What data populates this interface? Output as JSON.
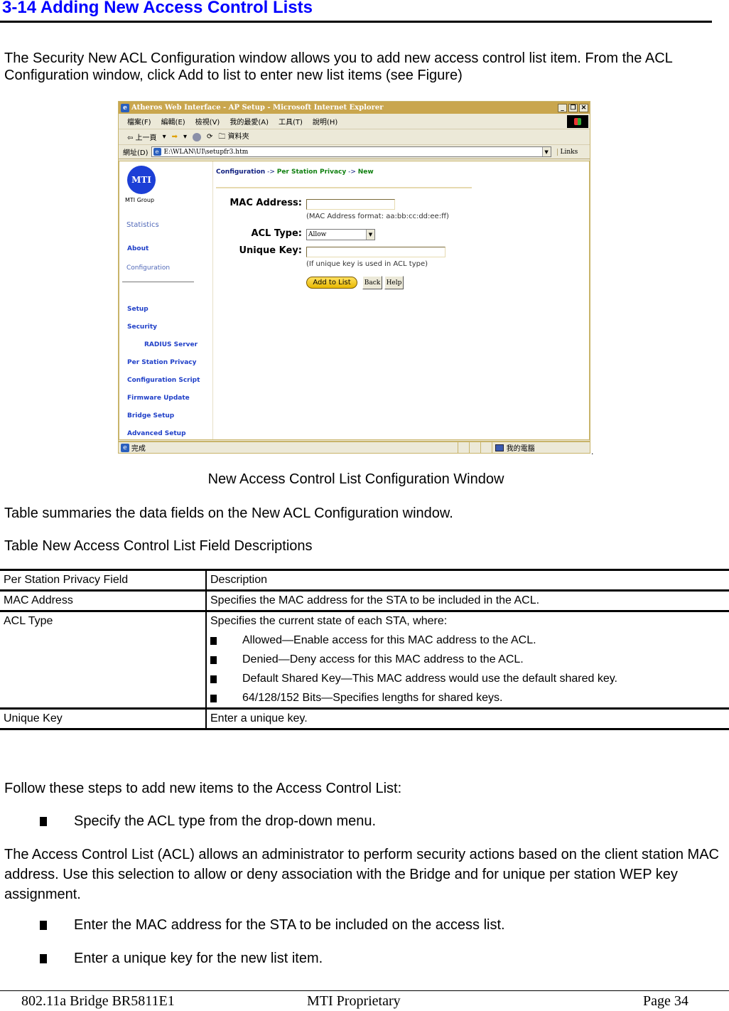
{
  "heading": "3-14 Adding New Access Control Lists",
  "intro": "The Security New ACL Configuration window allows you to add new access control list item. From the ACL Configuration window, click Add to list to enter new list items (see Figure)",
  "figure": {
    "window_title": "Atheros Web Interface - AP Setup - Microsoft Internet Explorer",
    "window_buttons": [
      "_",
      "❐",
      "✕"
    ],
    "menu": [
      "檔案(F)",
      "編輯(E)",
      "檢視(V)",
      "我的最愛(A)",
      "工具(T)",
      "說明(H)"
    ],
    "toolbar": {
      "back": "⇦ 上一頁",
      "back_drop": "▾",
      "forward": "➡",
      "forward_drop": "▾",
      "folders": "🗀 資料夾"
    },
    "address_label": "網址(D)",
    "address_value": "E:\\WLAN\\UI\\setupfr3.htm",
    "links_label": "Links",
    "sidebar": {
      "logo_text": "MTI",
      "brand": "MTI Group",
      "items": [
        {
          "label": "Statistics"
        },
        {
          "label": "About"
        },
        {
          "label": "Configuration"
        },
        {
          "label": "Setup"
        },
        {
          "label": "Security"
        },
        {
          "label": "RADIUS Server"
        },
        {
          "label": "Per Station Privacy"
        },
        {
          "label": "Configuration Script"
        },
        {
          "label": "Firmware Update"
        },
        {
          "label": "Bridge Setup"
        },
        {
          "label": "Advanced Setup"
        }
      ]
    },
    "breadcrumb": {
      "part1": "Configuration",
      "sep": " -> ",
      "part2": "Per Station Privacy",
      "part3": "New"
    },
    "form": {
      "mac_label": "MAC Address:",
      "mac_value": "",
      "mac_hint": "(MAC Address format: aa:bb:cc:dd:ee:ff)",
      "acl_label": "ACL Type:",
      "acl_selected": "Allow",
      "key_label": "Unique Key:",
      "key_value": "",
      "key_hint": "(If unique key is used in ACL type)",
      "add_button": "Add to List",
      "back_button": "Back",
      "help_button": "Help"
    },
    "status": {
      "text": "完成",
      "zone": "我的電腦"
    }
  },
  "caption": "New Access Control List Configuration Window",
  "table_intro": "Table summaries the data fields on the New ACL Configuration window.",
  "table_title": "Table New Access Control List Field Descriptions",
  "table": {
    "headers": [
      "Per Station Privacy Field",
      "Description"
    ],
    "rows": [
      {
        "field": "MAC Address",
        "description": "Specifies the MAC address for the STA to be included in the ACL."
      },
      {
        "field": "ACL Type",
        "description": "Specifies the current state of each STA, where:",
        "bullets": [
          "Allowed—Enable access for this MAC address to the ACL.",
          "Denied—Deny access for this MAC address to the ACL.",
          "Default Shared Key—This MAC address would use the default shared key.",
          "64/128/152 Bits—Specifies lengths for shared keys."
        ]
      },
      {
        "field": "Unique Key",
        "description": "Enter a unique key."
      }
    ]
  },
  "steps_intro": "Follow these steps to add new items to the Access Control List:",
  "steps": [
    "Specify the ACL type from the drop-down menu.",
    "Enter the MAC address for the STA to be included on the access list.",
    "Enter a unique key for the new list item."
  ],
  "acl_paragraph": "The Access Control List (ACL) allows an administrator to perform security actions based on the client station MAC address. Use this selection to allow or deny association with the Bridge and for unique per station WEP key assignment.",
  "footer": {
    "left": "802.11a Bridge BR5811E1",
    "center": "MTI Proprietary",
    "right": "Page 34"
  }
}
